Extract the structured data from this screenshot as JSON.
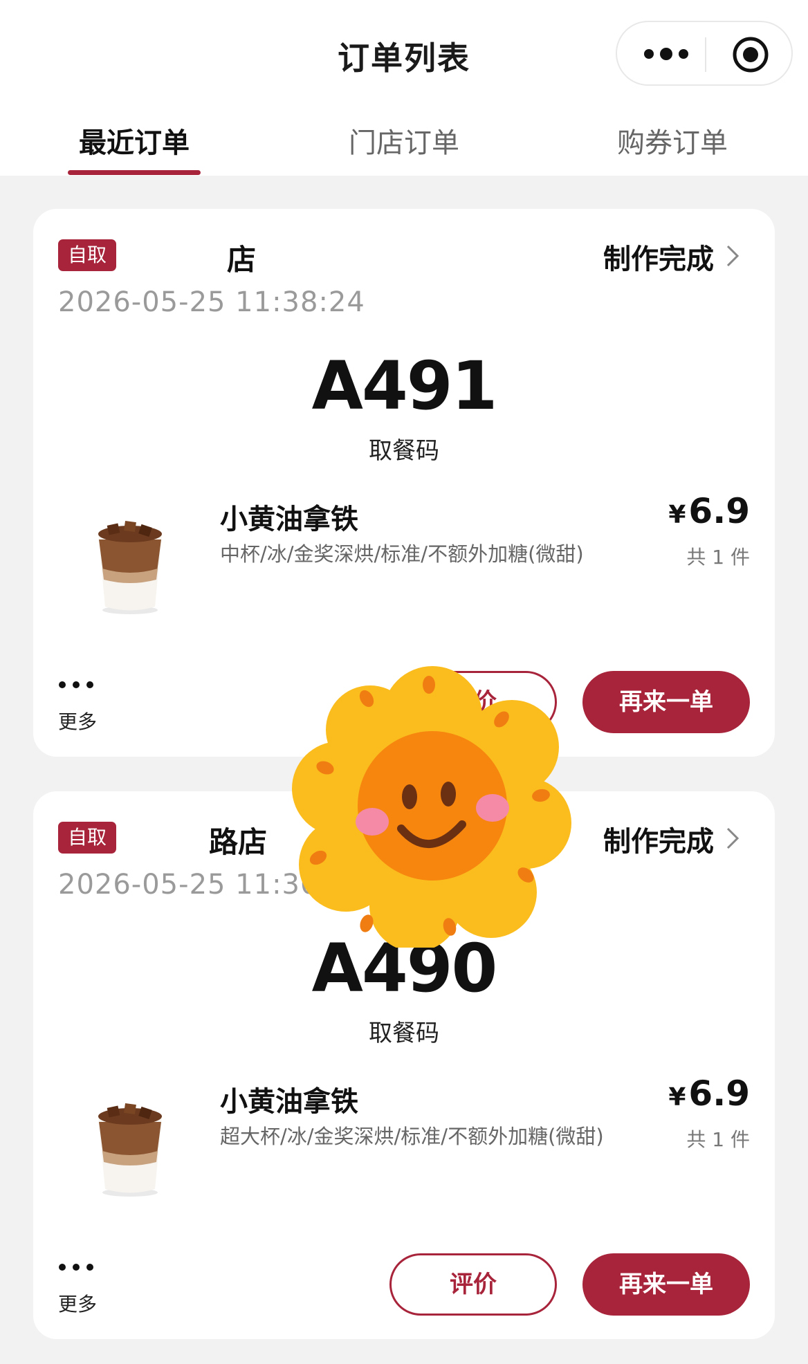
{
  "header": {
    "title": "订单列表"
  },
  "tabs": [
    {
      "label": "最近订单",
      "active": true
    },
    {
      "label": "门店订单",
      "active": false
    },
    {
      "label": "购券订单",
      "active": false
    }
  ],
  "orders": [
    {
      "badge": "自取",
      "store": "店",
      "status": "制作完成",
      "time": "2026-05-25 11:38:24",
      "pickup_code": "A491",
      "pickup_label": "取餐码",
      "product_name": "小黄油拿铁",
      "product_desc": "中杯/冰/金奖深烘/标准/不额外加糖(微甜)",
      "price_symbol": "¥",
      "price": "6.9",
      "qty": "共 1 件",
      "more_label": "更多",
      "review_label": "评价",
      "reorder_label": "再来一单"
    },
    {
      "badge": "自取",
      "store": "路店",
      "status": "制作完成",
      "time": "2026-05-25 11:36:13",
      "pickup_code": "A490",
      "pickup_label": "取餐码",
      "product_name": "小黄油拿铁",
      "product_desc": "超大杯/冰/金奖深烘/标准/不额外加糖(微甜)",
      "price_symbol": "¥",
      "price": "6.9",
      "qty": "共 1 件",
      "more_label": "更多",
      "review_label": "评价",
      "reorder_label": "再来一单"
    }
  ],
  "colors": {
    "accent": "#a8243b",
    "background": "#f2f2f2"
  },
  "icons": {
    "capsule_more": "more-dots-icon",
    "capsule_target": "target-icon",
    "status_chevron": "chevron-right-icon",
    "sticker": "sunflower-smiley-sticker"
  }
}
